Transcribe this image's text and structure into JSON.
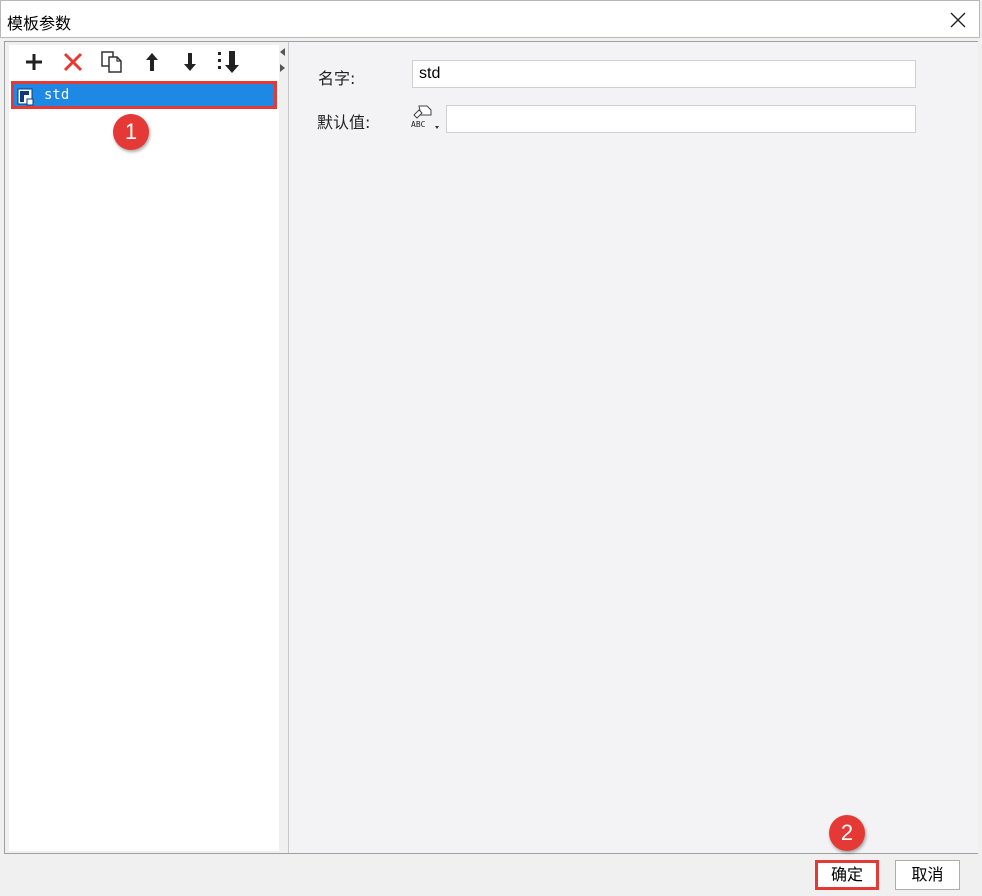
{
  "window": {
    "title": "模板参数",
    "close_icon": "close-icon"
  },
  "toolbar": {
    "buttons": [
      {
        "name": "add-icon",
        "color": "#222222"
      },
      {
        "name": "delete-icon",
        "color": "#e53935"
      },
      {
        "name": "copy-icon",
        "color": "#333333"
      },
      {
        "name": "move-up-icon",
        "color": "#222222"
      },
      {
        "name": "move-down-icon",
        "color": "#222222"
      },
      {
        "name": "move-to-bottom-icon",
        "color": "#222222"
      }
    ]
  },
  "parameter_list": {
    "items": [
      {
        "label": "std",
        "selected": true,
        "icon": "parameter-icon"
      }
    ]
  },
  "form": {
    "name_label": "名字:",
    "name_value": "std",
    "default_label": "默认值:",
    "default_value": "",
    "type_icon": "abc-string-type-icon"
  },
  "annotations": {
    "badge1": "1",
    "badge2": "2",
    "color": "#e53935"
  },
  "footer": {
    "ok_label": "确定",
    "cancel_label": "取消"
  },
  "colors": {
    "selection": "#1e88e5",
    "highlight": "#e53935"
  }
}
